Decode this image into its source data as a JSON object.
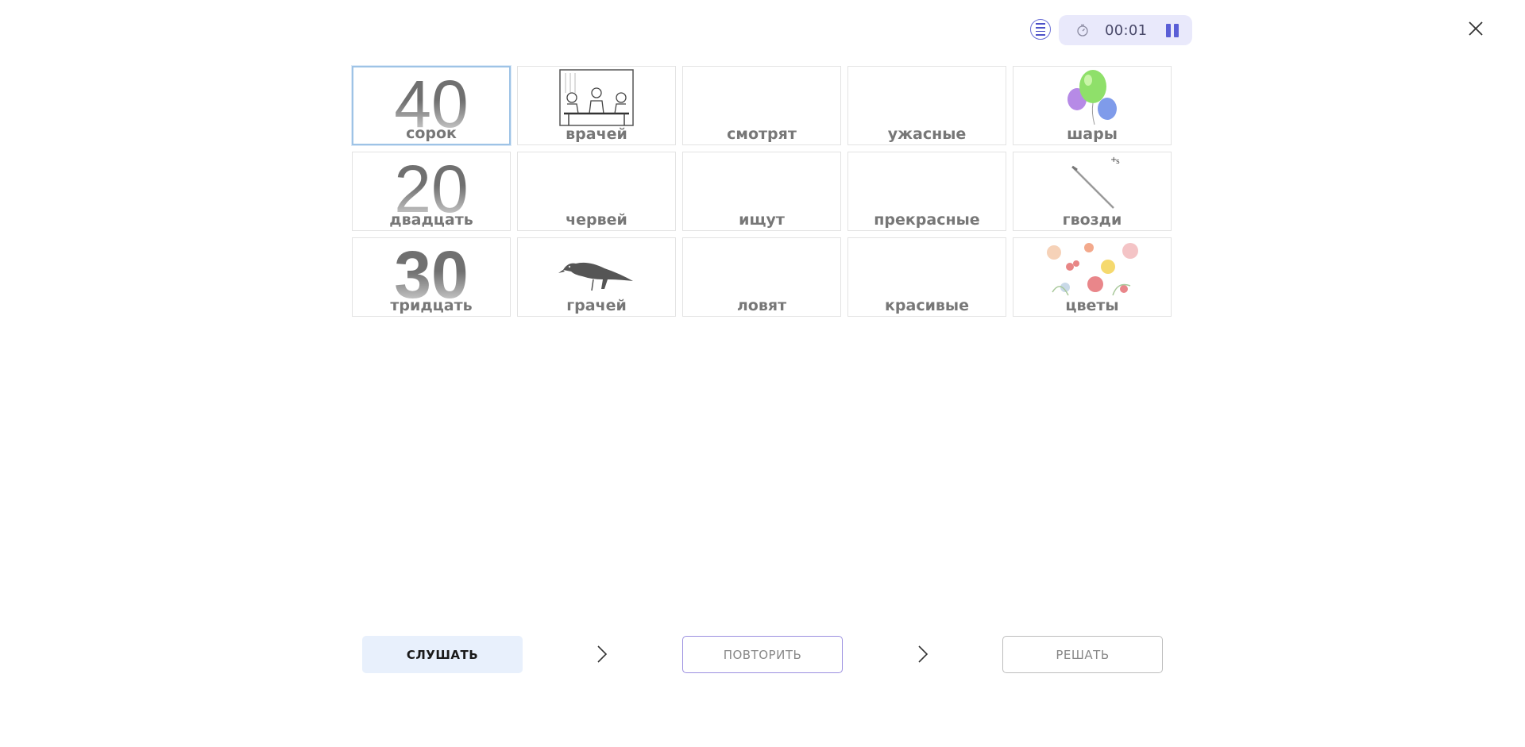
{
  "timer": {
    "time": "00:01"
  },
  "icons": {
    "menu": "list-icon",
    "timer": "stopwatch-icon",
    "pause": "pause-icon",
    "close": "close-icon",
    "arrow": "chevron-right-icon"
  },
  "colors": {
    "accent": "#5a5ed6",
    "timer_bg": "#e9e9fb",
    "listen_bg": "#e8f0fc",
    "selected_border": "#9ec3e6"
  },
  "cards": [
    {
      "label": "сорок",
      "number": "40",
      "selected": true
    },
    {
      "label": "врачей",
      "image": "doctors-icon"
    },
    {
      "label": "смотрят"
    },
    {
      "label": "ужасные"
    },
    {
      "label": "шары",
      "image": "balloons-icon"
    },
    {
      "label": "двадцать",
      "number": "20"
    },
    {
      "label": "червей"
    },
    {
      "label": "ищут"
    },
    {
      "label": "прекрасные"
    },
    {
      "label": "гвозди",
      "image": "nails-icon"
    },
    {
      "label": "тридцать",
      "number": "30"
    },
    {
      "label": "грачей",
      "image": "rook-bird-icon"
    },
    {
      "label": "ловят"
    },
    {
      "label": "красивые"
    },
    {
      "label": "цветы",
      "image": "flowers-icon"
    }
  ],
  "buttons": {
    "listen": "СЛУШАТЬ",
    "repeat": "ПОВТОРИТЬ",
    "solve": "РЕШАТЬ"
  }
}
